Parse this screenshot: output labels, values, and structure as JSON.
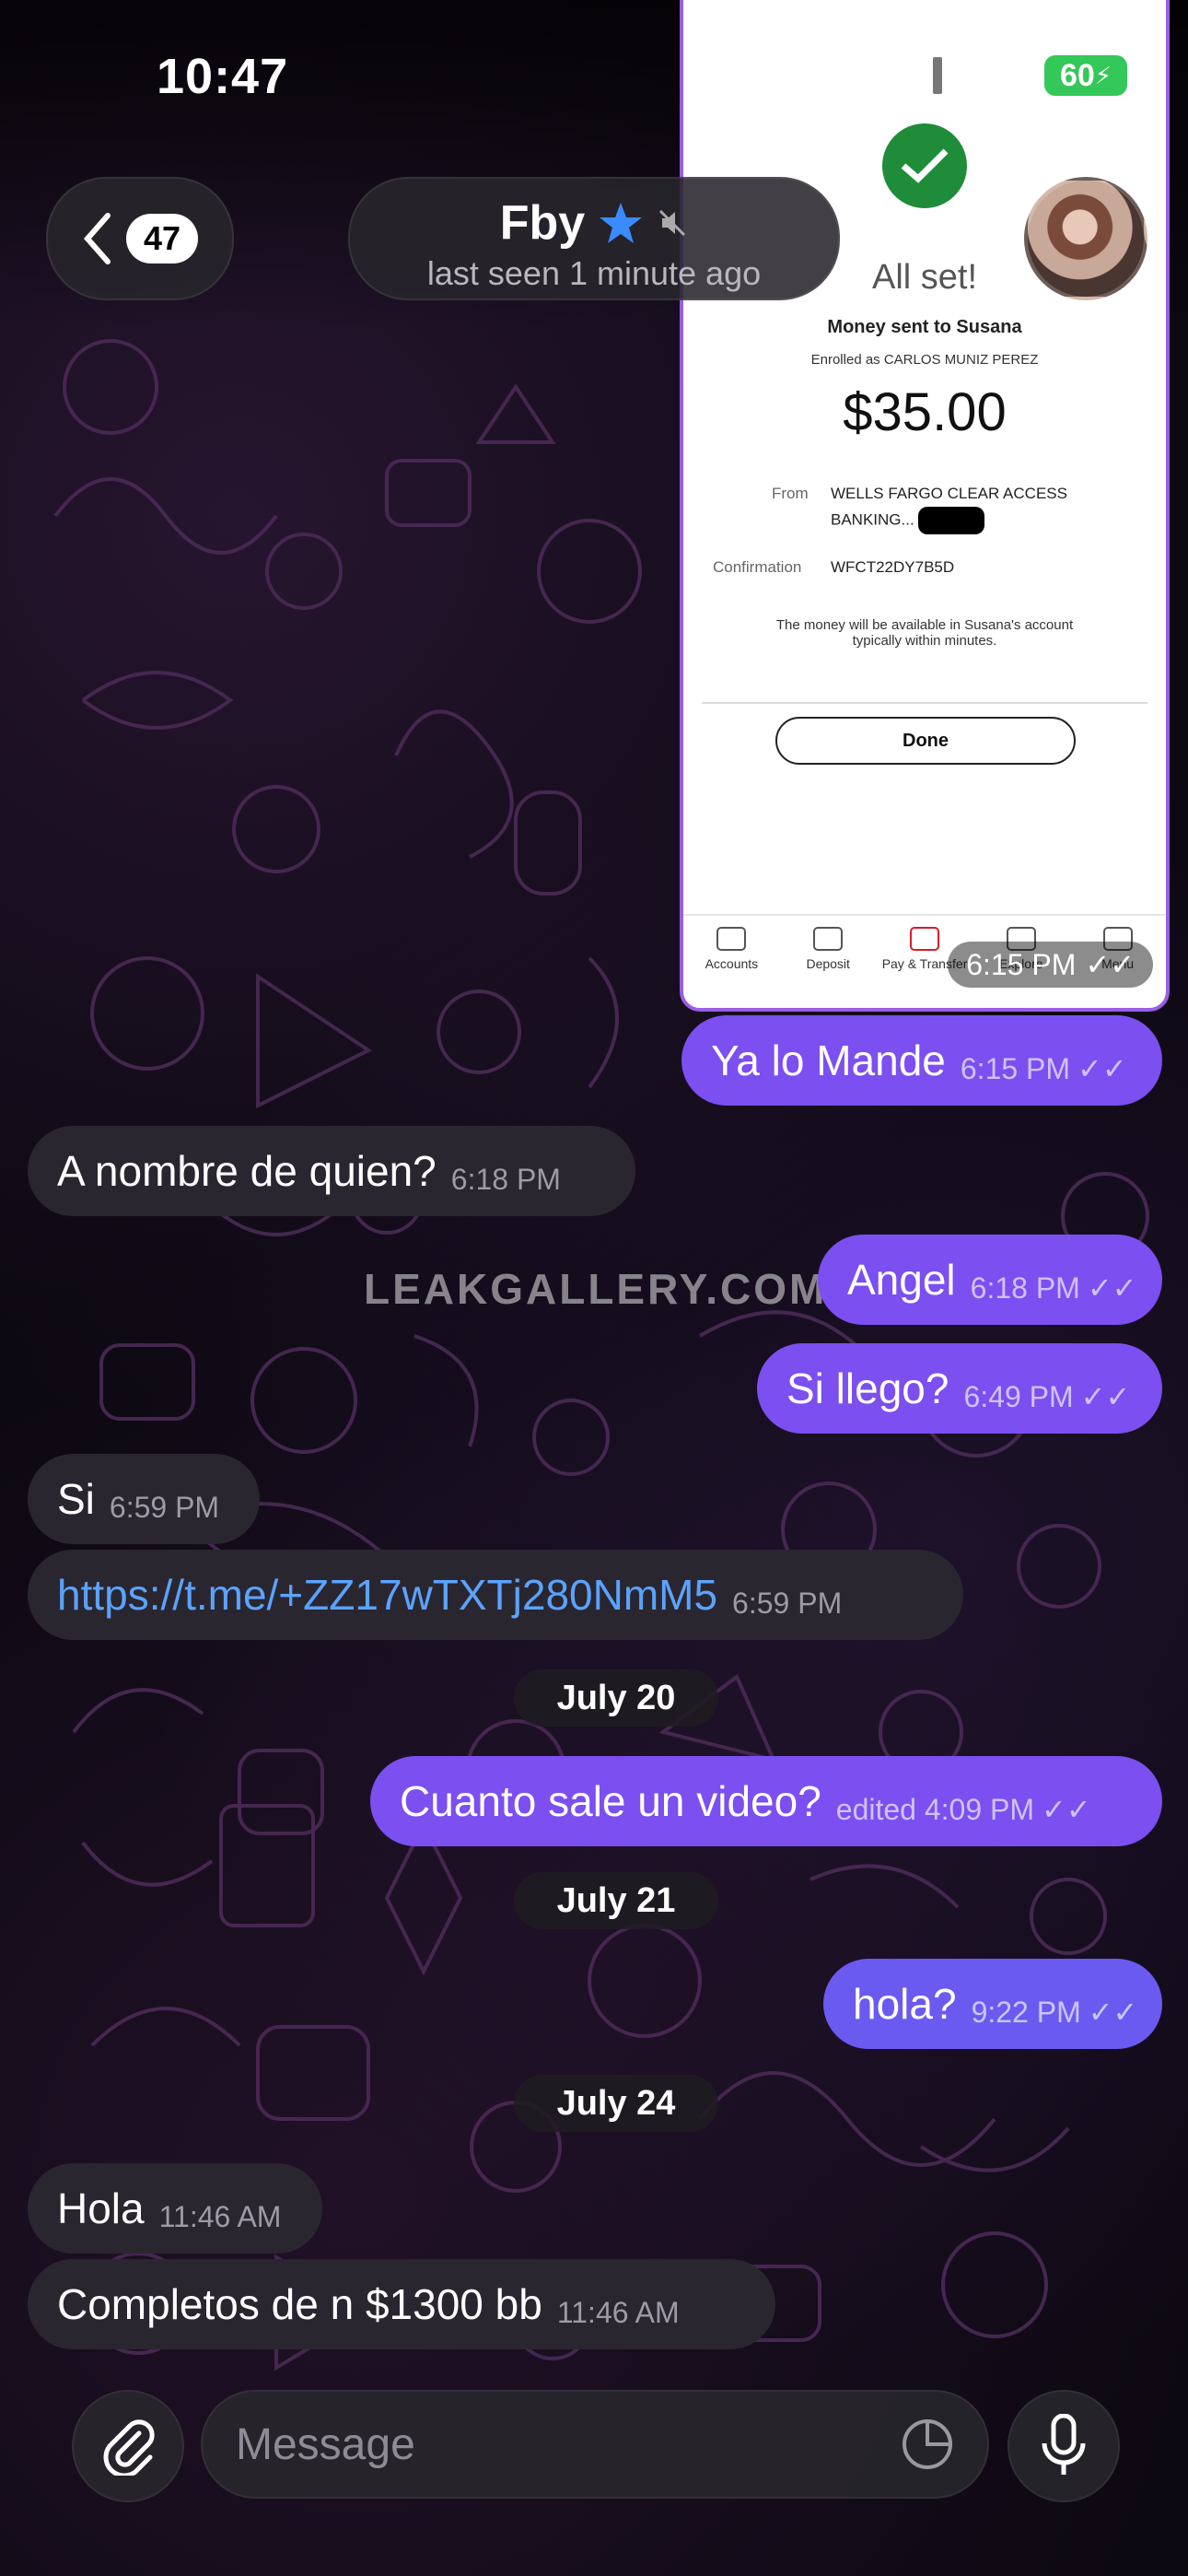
{
  "status_bar": {
    "time": "10:47",
    "battery": "60"
  },
  "header": {
    "back_count": "47",
    "contact_name": "Fby",
    "last_seen": "last seen 1 minute ago"
  },
  "screenshot_image": {
    "title": "All set!",
    "subtitle": "Money sent to Susana",
    "enrolled": "Enrolled as CARLOS MUNIZ PEREZ",
    "amount": "$35.00",
    "from_label": "From",
    "from_value_line1": "WELLS FARGO CLEAR ACCESS",
    "from_value_line2": "BANKING...",
    "confirmation_label": "Confirmation",
    "confirmation_value": "WFCT22DY7B5D",
    "note": "The money will be available in Susana's account typically within minutes.",
    "done_button": "Done",
    "tabs": [
      "Accounts",
      "Deposit",
      "Pay & Transfer",
      "Explore",
      "Menu"
    ],
    "time": "6:15 PM"
  },
  "messages": [
    {
      "text": "Ya lo Mande",
      "time": "6:15 PM",
      "direction": "out"
    },
    {
      "text": "A nombre de quien?",
      "time": "6:18 PM",
      "direction": "in"
    },
    {
      "text": "Angel",
      "time": "6:18 PM",
      "direction": "out"
    },
    {
      "text": "Si llego?",
      "time": "6:49 PM",
      "direction": "out"
    },
    {
      "text": "Si",
      "time": "6:59 PM",
      "direction": "in"
    },
    {
      "text": "https://t.me/+ZZ17wTXTj280NmM5",
      "time": "6:59 PM",
      "direction": "in"
    },
    {
      "text": "Cuanto sale un video?",
      "time": "edited 4:09 PM",
      "direction": "out"
    },
    {
      "text": "hola?",
      "time": "9:22 PM",
      "direction": "out"
    },
    {
      "text": "Hola",
      "time": "11:46 AM",
      "direction": "in"
    },
    {
      "text": "Completos de n $1300 bb",
      "time": "11:46 AM",
      "direction": "in"
    }
  ],
  "dates": [
    "July 20",
    "July 21",
    "July 24"
  ],
  "watermark": "LEAKGALLERY.COM",
  "composer": {
    "placeholder": "Message"
  },
  "colors": {
    "outgoing": "#7b4ff0",
    "incoming": "#2a2630",
    "link": "#5aa3ff",
    "battery": "#34c759"
  }
}
